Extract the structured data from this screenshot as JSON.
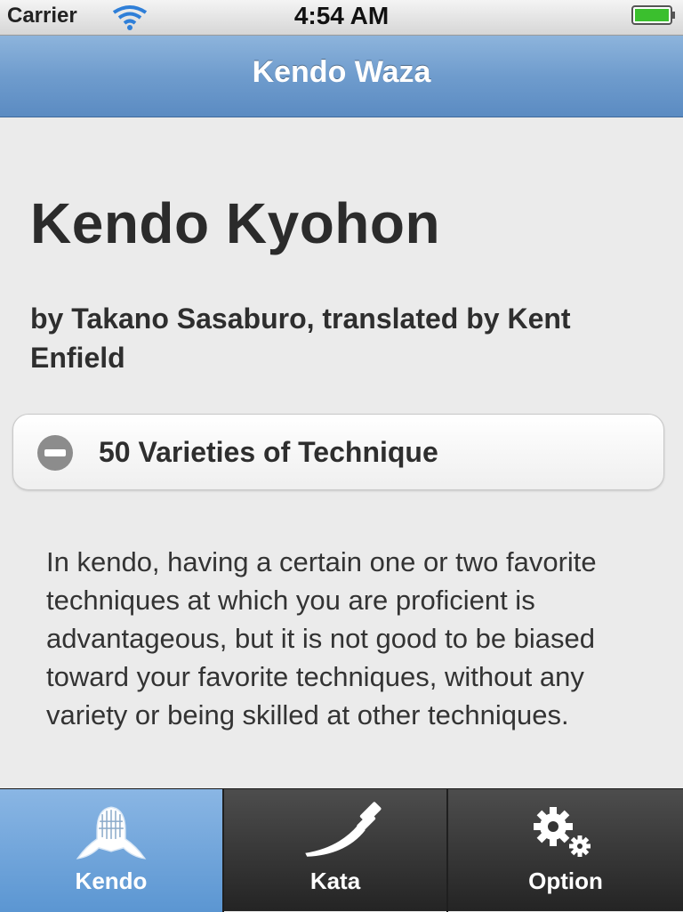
{
  "status_bar": {
    "carrier": "Carrier",
    "time": "4:54 AM"
  },
  "nav_bar": {
    "title": "Kendo Waza"
  },
  "content": {
    "title": "Kendo Kyohon",
    "byline": "by Takano Sasaburo, translated by Kent Enfield",
    "collapsible": {
      "label": "50 Varieties of Technique",
      "icon": "minus-circle-icon"
    },
    "body": "In kendo, having a certain one or two favorite techniques at which you are proficient is advantageous, but it is not good to be biased toward your favorite techniques, without any variety or being skilled at other techniques."
  },
  "tab_bar": {
    "tabs": [
      {
        "label": "Kendo",
        "icon": "kendo-mask-icon",
        "active": true
      },
      {
        "label": "Kata",
        "icon": "sword-icon",
        "active": false
      },
      {
        "label": "Option",
        "icon": "gear-icon",
        "active": false
      }
    ]
  },
  "colors": {
    "nav_bar": "#6f9ccd",
    "active_tab": "#5b96d2",
    "background": "#ebebeb"
  }
}
